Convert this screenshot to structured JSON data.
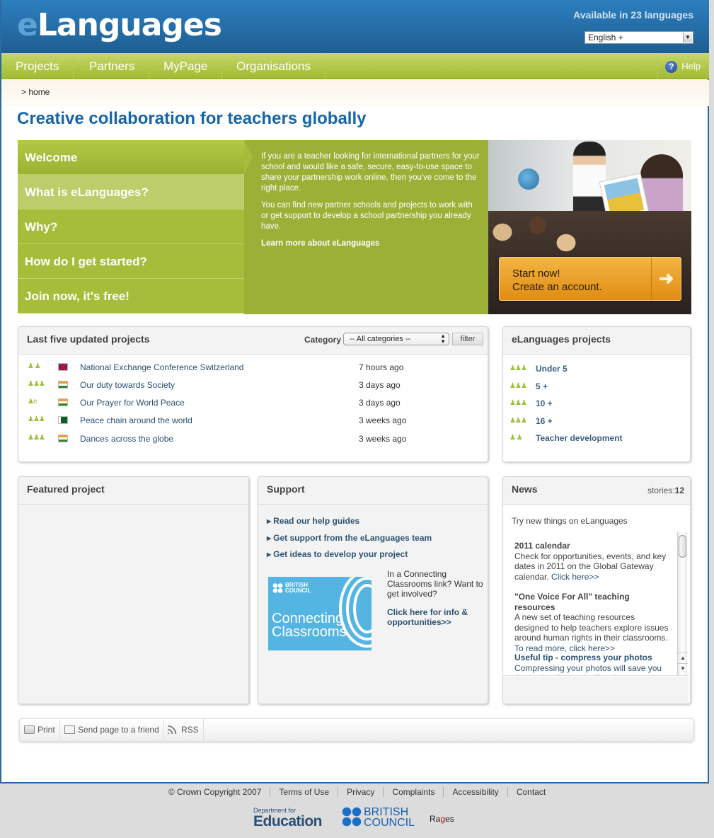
{
  "header": {
    "logo_prefix": "e",
    "logo_rest": "Languages",
    "available_text": "Available in 23 languages",
    "language_select": {
      "value": "English +",
      "arrow": "▼"
    }
  },
  "nav": {
    "items": [
      {
        "label": "Projects"
      },
      {
        "label": "Partners"
      },
      {
        "label": "MyPage"
      },
      {
        "label": "Organisations"
      }
    ],
    "help": {
      "icon": "?",
      "label": "Help"
    }
  },
  "breadcrumb": {
    "text": ">  home"
  },
  "page_title": "Creative collaboration for teachers globally",
  "hero": {
    "menu": [
      {
        "label": "Welcome",
        "active": true
      },
      {
        "label": "What is eLanguages?"
      },
      {
        "label": "Why?"
      },
      {
        "label": "How do I get started?"
      },
      {
        "label": "Join now, it's free!"
      }
    ],
    "paragraphs": [
      "If you are a teacher looking for international partners for your school and would like a safe, secure, easy-to-use space to share your partnership work online, then you've come to the right place.",
      "You can find new partner schools and projects to work with or get support to develop a school partnership you already have."
    ],
    "learn_more": "Learn more about eLanguages",
    "cta": {
      "line1": "Start now!",
      "line2": "Create an account.",
      "arrow": "➜"
    }
  },
  "last_projects": {
    "title": "Last five updated projects",
    "category_label": "Category",
    "category_value": "-- All categories --",
    "filter_label": "filter",
    "rows": [
      {
        "icons": "♟ ♟",
        "flag": "uk",
        "name": "National Exchange Conference Switzerland",
        "time": "7 hours ago"
      },
      {
        "icons": "♟♟♟",
        "flag": "in",
        "name": "Our duty towards Society",
        "time": "3 days ago"
      },
      {
        "icons": "♟e",
        "flag": "in",
        "name": "Our Prayer for World Peace",
        "time": "3 days ago"
      },
      {
        "icons": "♟♟♟",
        "flag": "pk",
        "name": "Peace chain around the world",
        "time": "3 weeks ago"
      },
      {
        "icons": "♟♟♟",
        "flag": "in",
        "name": "Dances across the globe",
        "time": "3 weeks ago"
      }
    ]
  },
  "elanguages_projects": {
    "title": "eLanguages projects",
    "items": [
      {
        "icons": "♟♟♟",
        "label": "Under 5"
      },
      {
        "icons": "♟♟♟",
        "label": "5 +"
      },
      {
        "icons": "♟♟♟",
        "label": "10 +"
      },
      {
        "icons": "♟♟♟",
        "label": "16 +"
      },
      {
        "icons": "♟ ♟",
        "label": "Teacher development"
      }
    ]
  },
  "featured": {
    "title": "Featured project"
  },
  "support": {
    "title": "Support",
    "links": [
      "Read our help guides",
      "Get support from the eLanguages team",
      "Get ideas to develop your project"
    ],
    "banner": {
      "brand_line1": "BRITISH",
      "brand_line2": "COUNCIL",
      "title_line1": "Connecting",
      "title_line2": "Classrooms"
    },
    "cc_text": "In a Connecting Classrooms link? Want to get involved?",
    "cc_link": "Click here for info & opportunities>>"
  },
  "news": {
    "title": "News",
    "stories_label": "stories:",
    "stories_count": "12",
    "intro": "Try new things on eLanguages",
    "items": [
      {
        "title": "2011 calendar",
        "body": "Check for opportunities, events, and key dates in 2011 on the Global Gateway calendar.",
        "link": "Click here>>"
      },
      {
        "title": "\"One Voice For All\" teaching resources",
        "body": "A new set of teaching resources designed to help teachers explore issues around human rights in their classrooms.",
        "link": "To read more, click here>>"
      },
      {
        "title": "Useful tip - compress your photos",
        "body": "Compressing your photos will save you time uploading and will make your pages"
      }
    ]
  },
  "tools": [
    {
      "icon": "print-icon",
      "label": "Print"
    },
    {
      "icon": "mail-icon",
      "label": "Send page to a friend"
    },
    {
      "icon": "rss-icon",
      "label": "RSS"
    }
  ],
  "footer": {
    "links": [
      "© Crown Copyright 2007",
      "Terms of Use",
      "Privacy",
      "Complaints",
      "Accessibility",
      "Contact"
    ],
    "dfe_small": "Department for",
    "dfe_big": "Education",
    "bc_line1": "BRITISH",
    "bc_line2": "COUNCIL",
    "rages_a": "Ra",
    "rages_g": "g",
    "rages_b": "es"
  }
}
